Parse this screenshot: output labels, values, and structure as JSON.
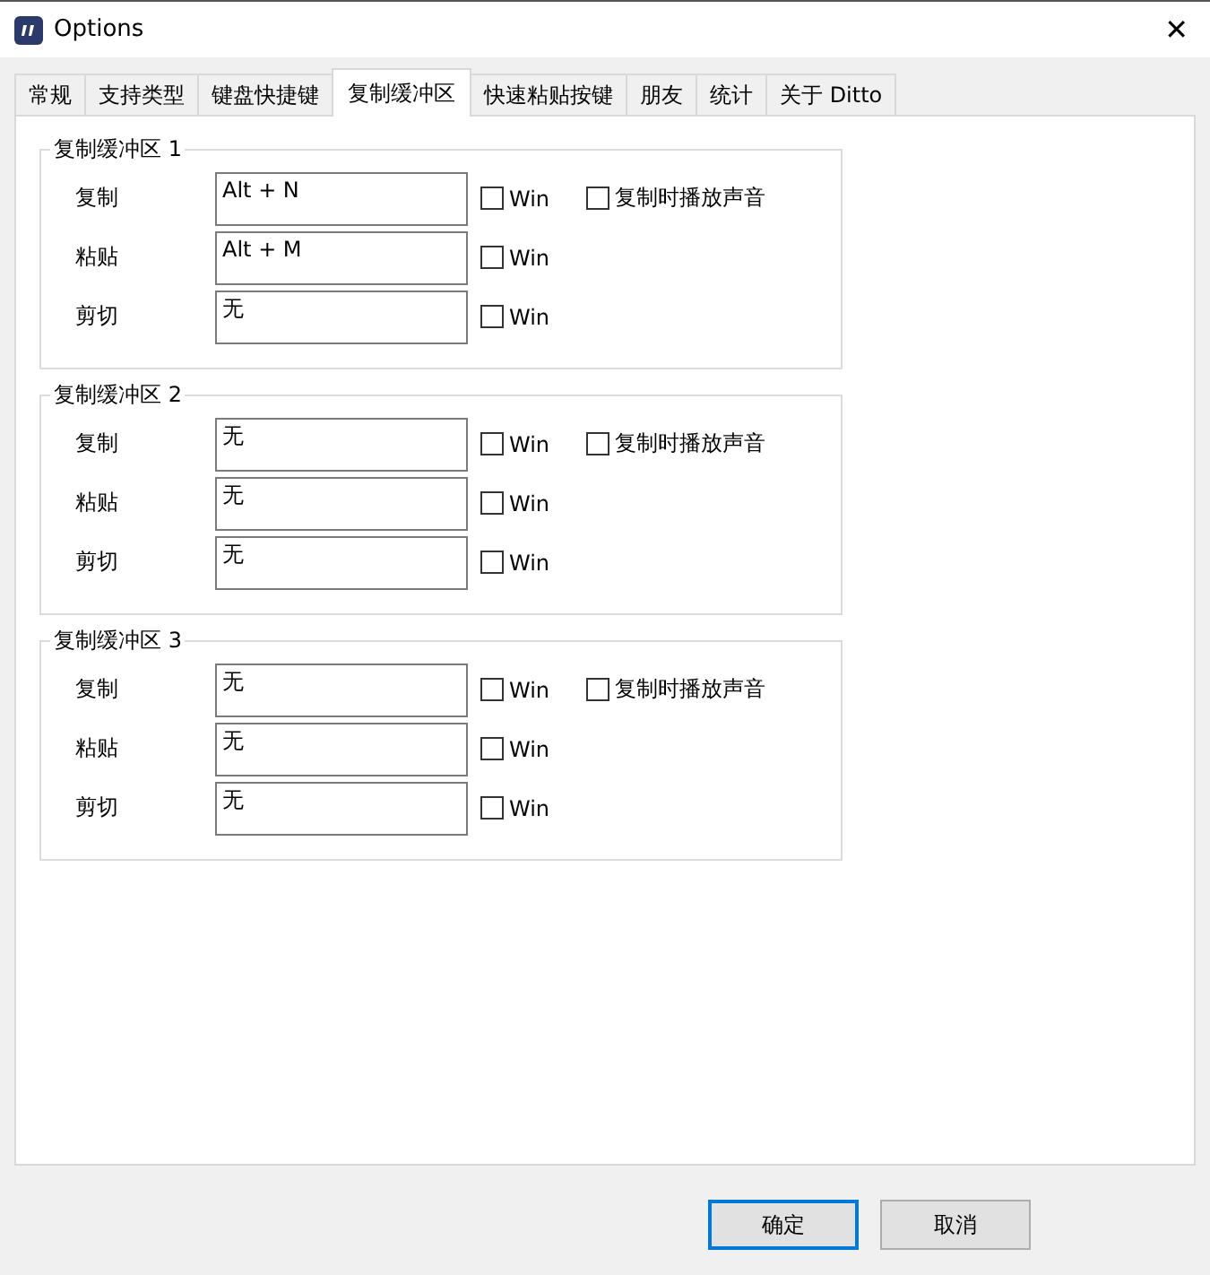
{
  "window": {
    "title": "Options",
    "close": "✕"
  },
  "tabs": [
    {
      "label": "常规",
      "selected": false
    },
    {
      "label": "支持类型",
      "selected": false
    },
    {
      "label": "键盘快捷键",
      "selected": false
    },
    {
      "label": "复制缓冲区",
      "selected": true
    },
    {
      "label": "快速粘贴按键",
      "selected": false
    },
    {
      "label": "朋友",
      "selected": false
    },
    {
      "label": "统计",
      "selected": false
    },
    {
      "label": "关于 Ditto",
      "selected": false
    }
  ],
  "groups": [
    {
      "title": "复制缓冲区 1",
      "rows": [
        {
          "label": "复制",
          "value": "Alt + N",
          "win": {
            "label": "Win",
            "checked": false
          },
          "sound": {
            "label": "复制时播放声音",
            "checked": false
          }
        },
        {
          "label": "粘贴",
          "value": "Alt + M",
          "win": {
            "label": "Win",
            "checked": false
          }
        },
        {
          "label": "剪切",
          "value": "无",
          "win": {
            "label": "Win",
            "checked": false
          }
        }
      ]
    },
    {
      "title": "复制缓冲区 2",
      "rows": [
        {
          "label": "复制",
          "value": "无",
          "win": {
            "label": "Win",
            "checked": false
          },
          "sound": {
            "label": "复制时播放声音",
            "checked": false
          }
        },
        {
          "label": "粘贴",
          "value": "无",
          "win": {
            "label": "Win",
            "checked": false
          }
        },
        {
          "label": "剪切",
          "value": "无",
          "win": {
            "label": "Win",
            "checked": false
          }
        }
      ]
    },
    {
      "title": "复制缓冲区 3",
      "rows": [
        {
          "label": "复制",
          "value": "无",
          "win": {
            "label": "Win",
            "checked": false
          },
          "sound": {
            "label": "复制时播放声音",
            "checked": false
          }
        },
        {
          "label": "粘贴",
          "value": "无",
          "win": {
            "label": "Win",
            "checked": false
          }
        },
        {
          "label": "剪切",
          "value": "无",
          "win": {
            "label": "Win",
            "checked": false
          }
        }
      ]
    }
  ],
  "buttons": [
    {
      "label": "确定",
      "default": true
    },
    {
      "label": "取消",
      "default": false
    }
  ]
}
